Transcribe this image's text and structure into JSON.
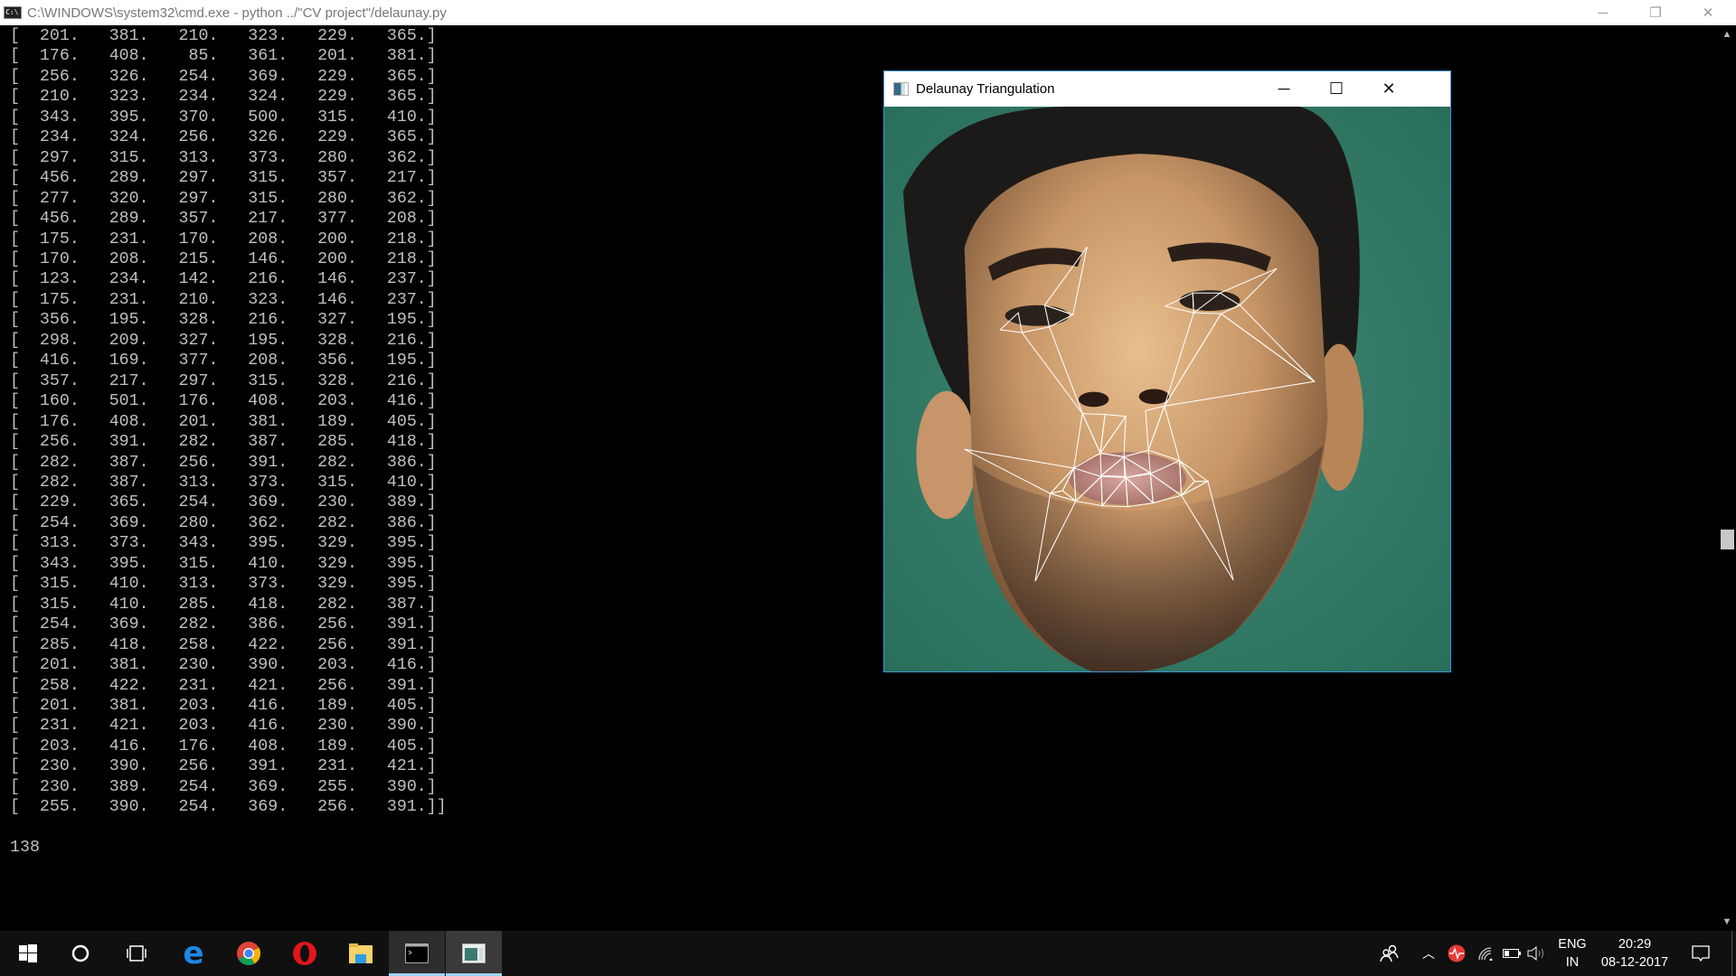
{
  "console_window": {
    "title": "C:\\WINDOWS\\system32\\cmd.exe - python  ../\"CV project\"/delaunay.py",
    "minimize": "─",
    "restore": "❐",
    "close": "✕",
    "triangles": [
      [
        201,
        381,
        210,
        323,
        229,
        365
      ],
      [
        176,
        408,
        85,
        361,
        201,
        381
      ],
      [
        256,
        326,
        254,
        369,
        229,
        365
      ],
      [
        210,
        323,
        234,
        324,
        229,
        365
      ],
      [
        343,
        395,
        370,
        500,
        315,
        410
      ],
      [
        234,
        324,
        256,
        326,
        229,
        365
      ],
      [
        297,
        315,
        313,
        373,
        280,
        362
      ],
      [
        456,
        289,
        297,
        315,
        357,
        217
      ],
      [
        277,
        320,
        297,
        315,
        280,
        362
      ],
      [
        456,
        289,
        357,
        217,
        377,
        208
      ],
      [
        175,
        231,
        170,
        208,
        200,
        218
      ],
      [
        170,
        208,
        215,
        146,
        200,
        218
      ],
      [
        123,
        234,
        142,
        216,
        146,
        237
      ],
      [
        175,
        231,
        210,
        323,
        146,
        237
      ],
      [
        356,
        195,
        328,
        216,
        327,
        195
      ],
      [
        298,
        209,
        327,
        195,
        328,
        216
      ],
      [
        416,
        169,
        377,
        208,
        356,
        195
      ],
      [
        357,
        217,
        297,
        315,
        328,
        216
      ],
      [
        160,
        501,
        176,
        408,
        203,
        416
      ],
      [
        176,
        408,
        201,
        381,
        189,
        405
      ],
      [
        256,
        391,
        282,
        387,
        285,
        418
      ],
      [
        282,
        387,
        256,
        391,
        282,
        386
      ],
      [
        282,
        387,
        313,
        373,
        315,
        410
      ],
      [
        229,
        365,
        254,
        369,
        230,
        389
      ],
      [
        254,
        369,
        280,
        362,
        282,
        386
      ],
      [
        313,
        373,
        343,
        395,
        329,
        395
      ],
      [
        343,
        395,
        315,
        410,
        329,
        395
      ],
      [
        315,
        410,
        313,
        373,
        329,
        395
      ],
      [
        315,
        410,
        285,
        418,
        282,
        387
      ],
      [
        254,
        369,
        282,
        386,
        256,
        391
      ],
      [
        285,
        418,
        258,
        422,
        256,
        391
      ],
      [
        201,
        381,
        230,
        390,
        203,
        416
      ],
      [
        258,
        422,
        231,
        421,
        256,
        391
      ],
      [
        201,
        381,
        203,
        416,
        189,
        405
      ],
      [
        231,
        421,
        203,
        416,
        230,
        390
      ],
      [
        203,
        416,
        176,
        408,
        189,
        405
      ],
      [
        230,
        390,
        256,
        391,
        231,
        421
      ],
      [
        230,
        389,
        254,
        369,
        255,
        390
      ],
      [
        255,
        390,
        254,
        369,
        256,
        391
      ]
    ],
    "count_output": "138"
  },
  "delaunay_window": {
    "title": "Delaunay Triangulation",
    "minimize": "─",
    "maximize": "☐",
    "close": "✕",
    "edge_color": "#ffffff"
  },
  "taskbar": {
    "apps": [
      "start",
      "cortana",
      "task-view",
      "edge",
      "chrome",
      "opera",
      "file-explorer",
      "command-prompt",
      "delaunay-window"
    ],
    "language": "ENG",
    "region": "IN",
    "time": "20:29",
    "date": "08-12-2017"
  }
}
